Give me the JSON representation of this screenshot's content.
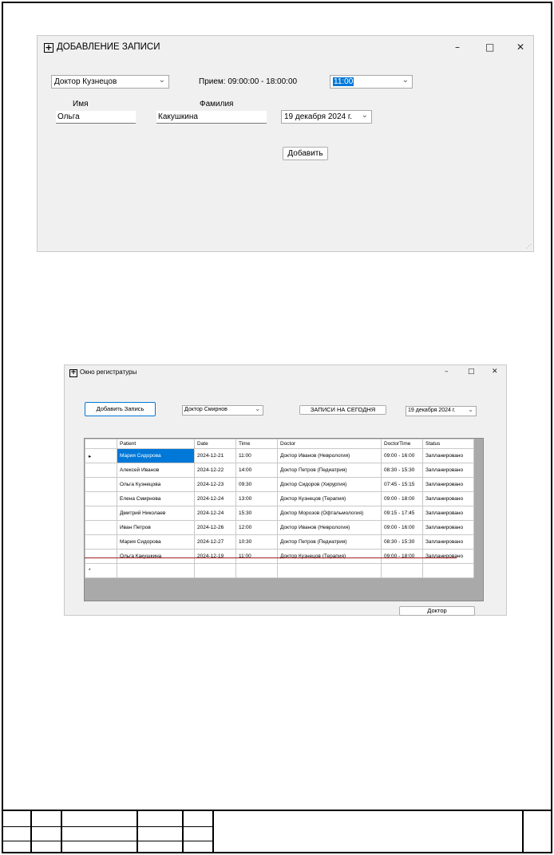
{
  "add_window": {
    "title": "ДОБАВЛЕНИЕ ЗАПИСИ",
    "icon": "plus-box-icon",
    "controls": {
      "minimize": "–",
      "maximize": "□",
      "close": "✕"
    },
    "doctor_select": "Доктор Кузнецов",
    "reception_hours": "Прием: 09:00:00 - 18:00:00",
    "time_select": "11:00",
    "first_name_label": "Имя",
    "last_name_label": "Фамилия",
    "first_name_value": "Ольга",
    "last_name_value": "Какушкина",
    "date_select": "19 декабря  2024 г.",
    "add_button": "Добавить"
  },
  "registry_window": {
    "title": "Окно регистратуры",
    "icon": "plus-box-icon",
    "controls": {
      "minimize": "–",
      "maximize": "□",
      "close": "✕"
    },
    "add_record_button": "Добавить Запись",
    "doctor_select": "Доктор Смирнов",
    "today_button": "ЗАПИСИ НА СЕГОДНЯ",
    "date_select": "19 декабря  2024 г.",
    "doctor_button": "Доктор",
    "table": {
      "columns": [
        "Patient",
        "Date",
        "Time",
        "Doctor",
        "DoctorTime",
        "Status"
      ],
      "rows": [
        [
          "Мария Сидорова",
          "2024-12-21",
          "11:00",
          "Доктор Иванов (Неврология)",
          "09:00 - 16:00",
          "Запланировано"
        ],
        [
          "Алексей Иванов",
          "2024-12-22",
          "14:00",
          "Доктор Петров (Педиатрия)",
          "08:30 - 15:30",
          "Запланировано"
        ],
        [
          "Ольга Кузнецова",
          "2024-12-23",
          "09:30",
          "Доктор Сидоров (Хирургия)",
          "07:45 - 15:15",
          "Запланировано"
        ],
        [
          "Елена Смирнова",
          "2024-12-24",
          "13:00",
          "Доктор Кузнецов (Терапия)",
          "09:00 - 18:00",
          "Запланировано"
        ],
        [
          "Дмитрий Николаев",
          "2024-12-24",
          "15:30",
          "Доктор Морозов (Офтальмология)",
          "09:15 - 17:45",
          "Запланировано"
        ],
        [
          "Иван Петров",
          "2024-12-26",
          "12:00",
          "Доктор Иванов (Неврология)",
          "09:00 - 16:00",
          "Запланировано"
        ],
        [
          "Мария Сидорова",
          "2024-12-27",
          "10:30",
          "Доктор Петров (Педиатрия)",
          "08:30 - 15:30",
          "Запланировано"
        ],
        [
          "Ольга Какушкина",
          "2024-12-19",
          "11:00",
          "Доктор Кузнецов (Терапия)",
          "09:00 - 18:00",
          "Запланировано"
        ]
      ],
      "current_row_marker": "▸",
      "new_row_marker": "*"
    }
  }
}
